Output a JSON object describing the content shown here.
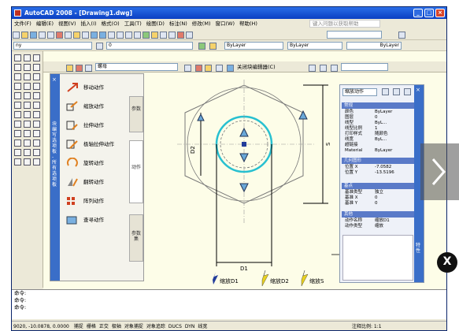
{
  "window": {
    "title": "AutoCAD 2008 - [Drawing1.dwg]"
  },
  "menu": [
    "文件(F)",
    "编辑(E)",
    "视图(V)",
    "插入(I)",
    "格式(O)",
    "工具(T)",
    "绘图(D)",
    "标注(N)",
    "修改(M)",
    "窗口(W)",
    "帮助(H)"
  ],
  "help_search": {
    "placeholder": "键入问题以获取帮助"
  },
  "toolbar": {
    "workspace": "ny",
    "layer": "0",
    "linetype": "ByLayer",
    "lineweight": "ByLayer",
    "color": "ByLayer"
  },
  "block_editor": {
    "block_name": "螺母",
    "close_label": "关闭块编辑器(C)"
  },
  "palette": {
    "title": "块编写选项板 - 所有选项板",
    "items": [
      "移动动作",
      "缩放动作",
      "拉伸动作",
      "极轴拉伸动作",
      "旋转动作",
      "翻转动作",
      "阵列动作",
      "查寻动作"
    ],
    "tabs": [
      "参数",
      "动作",
      "参数集"
    ]
  },
  "drawing": {
    "labels": [
      "D2",
      "D1",
      "S"
    ],
    "actions": [
      "缩放D1",
      "缩放D2",
      "缩放S"
    ]
  },
  "properties": {
    "selected": "缩放动作",
    "title": "特性",
    "sections": {
      "general": "常规",
      "misc": "其他",
      "overrides": "基点",
      "action": "其他"
    },
    "general": [
      {
        "k": "颜色",
        "v": "ByLayer"
      },
      {
        "k": "图层",
        "v": "0"
      },
      {
        "k": "线型",
        "v": "ByL..."
      },
      {
        "k": "线型比例",
        "v": "1"
      },
      {
        "k": "打印样式",
        "v": "随颜色"
      },
      {
        "k": "线宽",
        "v": "ByL..."
      },
      {
        "k": "超链接",
        "v": ""
      },
      {
        "k": "Material",
        "v": "ByLayer"
      }
    ],
    "geometry_title": "几何图形",
    "geometry": [
      {
        "k": "位置 X",
        "v": "-7.0582"
      },
      {
        "k": "位置 Y",
        "v": "-13.5196"
      }
    ],
    "base": [
      {
        "k": "基准类型",
        "v": "独立"
      },
      {
        "k": "基准 X",
        "v": "0"
      },
      {
        "k": "基准 Y",
        "v": "0"
      }
    ],
    "misc": [
      {
        "k": "动作名称",
        "v": "缩放D1"
      },
      {
        "k": "动作类型",
        "v": "缩放"
      }
    ]
  },
  "command": {
    "lines": [
      "命令:",
      "命令:",
      "命令:"
    ]
  },
  "status": {
    "coords": "9020, -10.0878, 0.0000",
    "toggles": [
      "捕捉",
      "栅格",
      "正交",
      "极轴",
      "对象捕捉",
      "对象追踪",
      "DUCS",
      "DYN",
      "线宽"
    ],
    "scale": "注释比例: 1:1"
  },
  "overlay": {
    "close": "X"
  }
}
